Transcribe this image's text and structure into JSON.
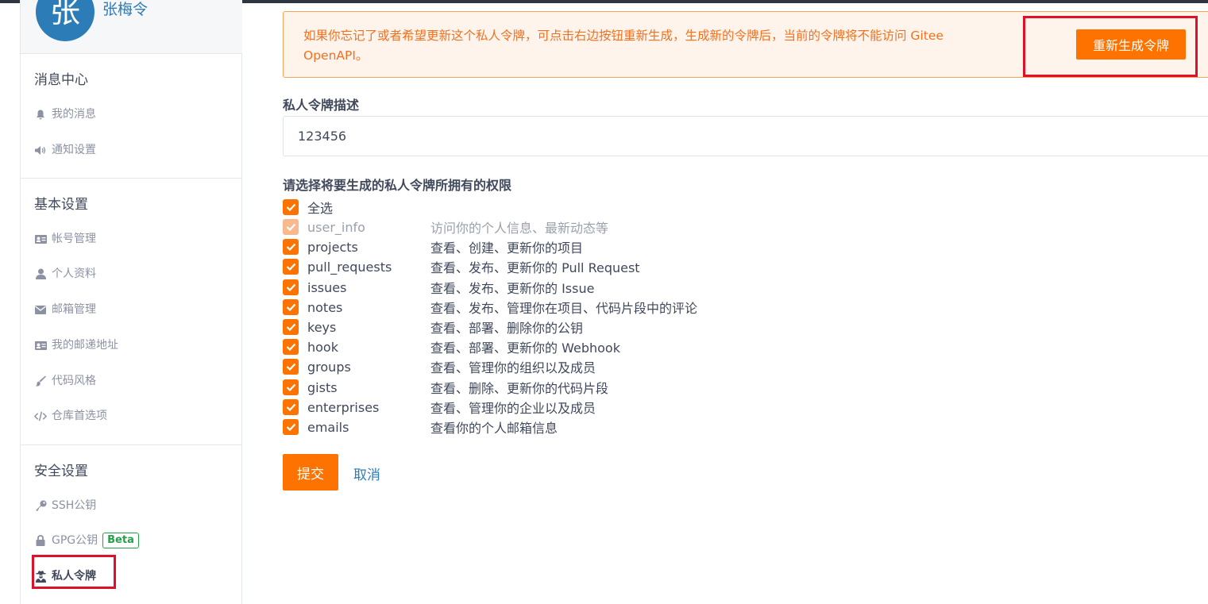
{
  "user": {
    "avatar_char": "张",
    "name": "张梅令"
  },
  "sidebar": {
    "sections": [
      {
        "title": "消息中心",
        "items": [
          {
            "label": "我的消息",
            "icon": "bell-icon"
          },
          {
            "label": "通知设置",
            "icon": "volume-icon"
          }
        ]
      },
      {
        "title": "基本设置",
        "items": [
          {
            "label": "帐号管理",
            "icon": "id-card-icon"
          },
          {
            "label": "个人资料",
            "icon": "user-icon"
          },
          {
            "label": "邮箱管理",
            "icon": "envelope-icon"
          },
          {
            "label": "我的邮递地址",
            "icon": "id-card-icon"
          },
          {
            "label": "代码风格",
            "icon": "brush-icon"
          },
          {
            "label": "仓库首选项",
            "icon": "code-icon"
          }
        ]
      },
      {
        "title": "安全设置",
        "items": [
          {
            "label": "SSH公钥",
            "icon": "key-icon"
          },
          {
            "label": "GPG公钥",
            "icon": "lock-icon",
            "badge": "Beta"
          },
          {
            "label": "私人令牌",
            "icon": "user-secret-icon",
            "active": true
          }
        ]
      }
    ]
  },
  "notice": {
    "text": "如果你忘记了或者希望更新这个私人令牌，可点击右边按钮重新生成，生成新的令牌后，当前的令牌将不能访问 Gitee OpenAPI。",
    "button": "重新生成令牌"
  },
  "form": {
    "desc_label": "私人令牌描述",
    "desc_value": "123456",
    "perm_label": "请选择将要生成的私人令牌所拥有的权限",
    "select_all": "全选",
    "permissions": [
      {
        "name": "user_info",
        "desc": "访问你的个人信息、最新动态等",
        "disabled": true
      },
      {
        "name": "projects",
        "desc": "查看、创建、更新你的项目"
      },
      {
        "name": "pull_requests",
        "desc": "查看、发布、更新你的 Pull Request"
      },
      {
        "name": "issues",
        "desc": "查看、发布、更新你的 Issue"
      },
      {
        "name": "notes",
        "desc": "查看、发布、管理你在项目、代码片段中的评论"
      },
      {
        "name": "keys",
        "desc": "查看、部署、删除你的公钥"
      },
      {
        "name": "hook",
        "desc": "查看、部署、更新你的 Webhook"
      },
      {
        "name": "groups",
        "desc": "查看、管理你的组织以及成员"
      },
      {
        "name": "gists",
        "desc": "查看、删除、更新你的代码片段"
      },
      {
        "name": "enterprises",
        "desc": "查看、管理你的企业以及成员"
      },
      {
        "name": "emails",
        "desc": "查看你的个人邮箱信息"
      }
    ],
    "submit": "提交",
    "cancel": "取消"
  },
  "colors": {
    "accent": "#fe7300",
    "link": "#2c7cb8",
    "highlight_box": "#e0102a",
    "badge": "#24a148"
  }
}
